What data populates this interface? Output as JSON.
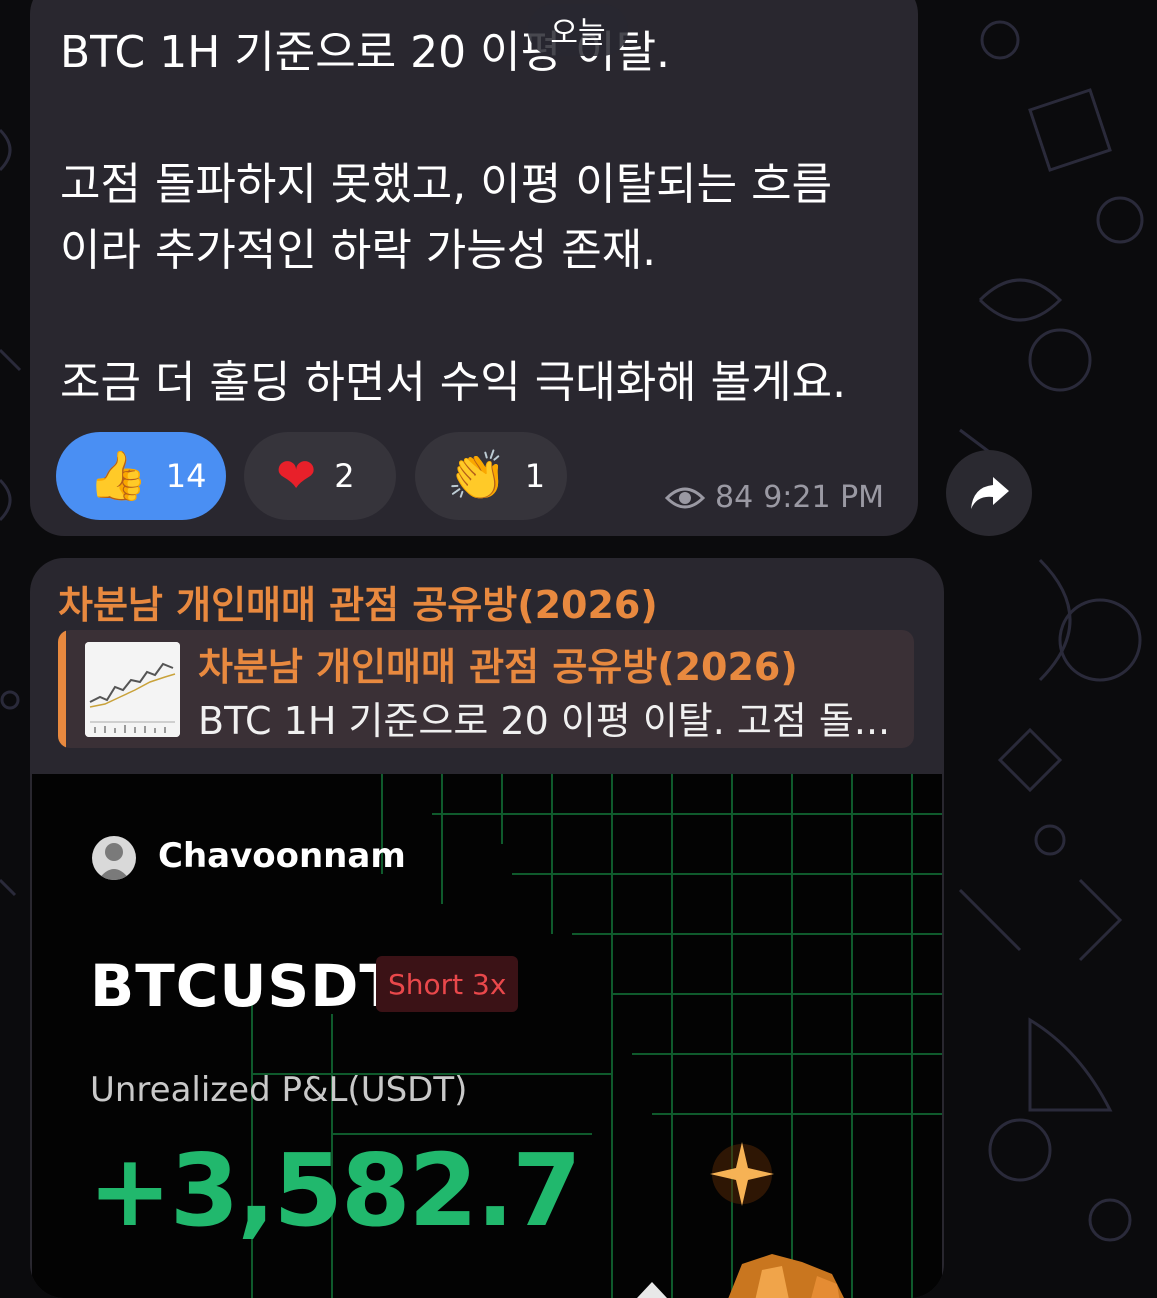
{
  "date_pill": "오늘",
  "message1": {
    "text": "BTC 1H 기준으로 20 이평 이탈.\n\n고점 돌파하지 못했고, 이평 이탈되는 흐름\n이라 추가적인 하락 가능성 존재.\n\n조금 더 홀딩 하면서 수익 극대화해 볼게요.",
    "reactions": [
      {
        "emoji": "👍",
        "count": "14"
      },
      {
        "emoji": "❤",
        "count": "2"
      },
      {
        "emoji": "👏",
        "count": "1"
      }
    ],
    "views": "84",
    "time": "9:21 PM"
  },
  "message2": {
    "sender": "차분남 개인매매 관점 공유방(2026)",
    "reply": {
      "title": "차분남 개인매매 관점 공유방(2026)",
      "text": "BTC 1H 기준으로 20 이평 이탈. 고점 돌..."
    },
    "card": {
      "username": "Chavoonnam",
      "symbol": "BTCUSDT",
      "side": "Short 3x",
      "pnl_label": "Unrealized P&L(USDT)",
      "pnl_value": "+3,582.7"
    }
  },
  "colors": {
    "accent_blue": "#4a8ff3",
    "sender_orange": "#e8893f",
    "profit_green": "#21b86d",
    "short_red": "#e9484b"
  }
}
